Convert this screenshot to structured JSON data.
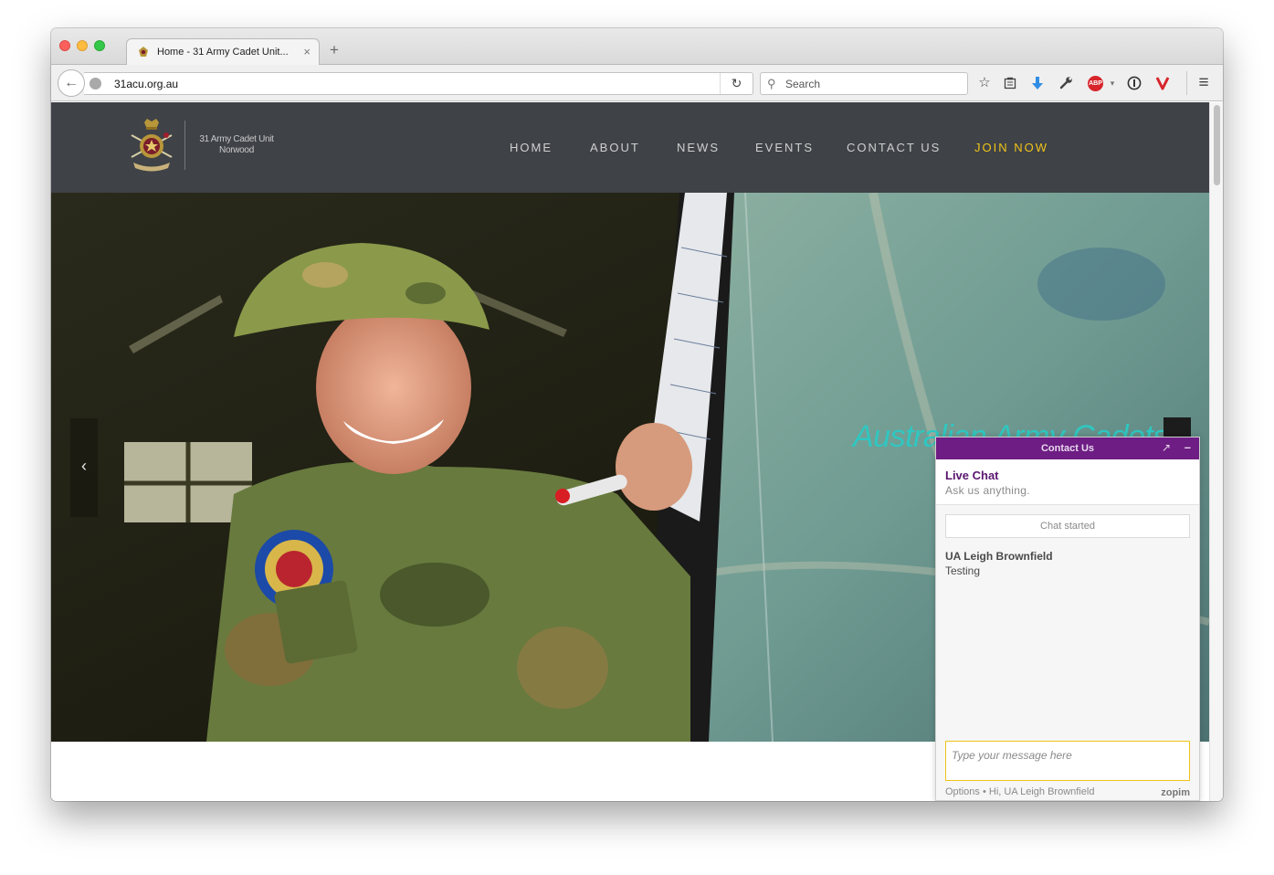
{
  "browser": {
    "tab_title": "Home - 31 Army Cadet Unit...",
    "tab_close": "×",
    "new_tab": "+",
    "url": "31acu.org.au",
    "search_placeholder": "Search",
    "back_glyph": "←",
    "reload_glyph": "↻",
    "toolbar_icons": [
      "bookmark-star-icon",
      "reading-list-icon",
      "download-icon",
      "wrench-icon",
      "adblock-icon",
      "info-icon",
      "vivaldi-icon",
      "menu-icon"
    ],
    "abp_label": "ABP",
    "menu_glyph": "≡"
  },
  "site": {
    "logo_line1": "31 Army Cadet Unit",
    "logo_line2": "Norwood",
    "nav": [
      "HOME",
      "ABOUT",
      "NEWS",
      "EVENTS",
      "CONTACT US",
      "JOIN NOW"
    ],
    "accent_color": "#f0c419",
    "header_color": "#3f4247"
  },
  "hero": {
    "caption": "Australian Army Cadets",
    "prev_glyph": "‹",
    "caption_color": "#2fc7c1"
  },
  "chat": {
    "header_title": "Contact Us",
    "popout_glyph": "↗",
    "minimize_glyph": "–",
    "live_chat": "Live Chat",
    "ask": "Ask us anything.",
    "started": "Chat started",
    "agent_name": "UA Leigh Brownfield",
    "message": "Testing",
    "input_placeholder": "Type your message here",
    "footer": "Options • Hi, UA Leigh Brownfield",
    "brand": "zopim",
    "header_color": "#6d1d83"
  }
}
